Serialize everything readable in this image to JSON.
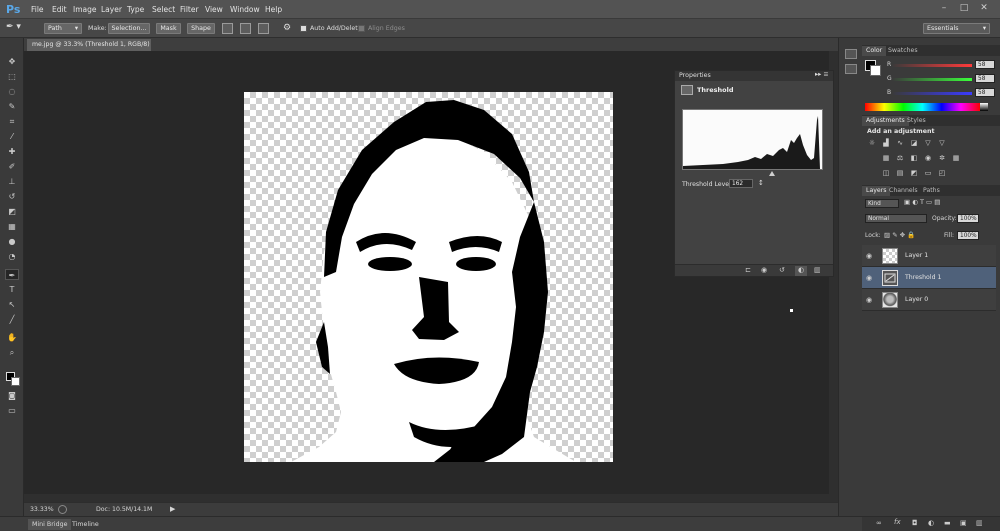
{
  "app": {
    "logo": "Ps"
  },
  "menu": [
    "File",
    "Edit",
    "Image",
    "Layer",
    "Type",
    "Select",
    "Filter",
    "View",
    "Window",
    "Help"
  ],
  "window_controls": {
    "minimize": "–",
    "maximize": "□",
    "close": "✕"
  },
  "options_bar": {
    "mode_value": "Path",
    "make_label": "Make:",
    "selection_label": "Selection...",
    "mask_label": "Mask",
    "shape_label": "Shape",
    "auto_add_delete": "Auto Add/Delete",
    "align_edges": "Align Edges",
    "workspace": "Essentials"
  },
  "document": {
    "tab_title": "me.jpg @ 33.3% (Threshold 1, RGB/8) *"
  },
  "status": {
    "zoom": "33.33%",
    "doc_info": "Doc: 10.5M/14.1M"
  },
  "bottom_tabs": [
    "Mini Bridge",
    "Timeline"
  ],
  "properties": {
    "tab": "Properties",
    "adjustment_name": "Threshold",
    "level_label": "Threshold Level:",
    "level_value": "162",
    "level": 162
  },
  "color_panel": {
    "tabs": [
      "Color",
      "Swatches"
    ],
    "channels": [
      {
        "label": "R",
        "value": "58"
      },
      {
        "label": "G",
        "value": "58"
      },
      {
        "label": "B",
        "value": "58"
      }
    ]
  },
  "adjustments_panel": {
    "tabs": [
      "Adjustments",
      "Styles"
    ],
    "heading": "Add an adjustment"
  },
  "layers_panel": {
    "tabs": [
      "Layers",
      "Channels",
      "Paths"
    ],
    "kind": "Kind",
    "blend_mode": "Normal",
    "opacity_label": "Opacity:",
    "opacity_value": "100%",
    "lock_label": "Lock:",
    "fill_label": "Fill:",
    "fill_value": "100%",
    "layers": [
      {
        "name": "Layer 1",
        "selected": false
      },
      {
        "name": "Threshold 1",
        "selected": true
      },
      {
        "name": "Layer 0",
        "selected": false
      }
    ]
  },
  "colors": {
    "accent_selected": "#4f617a",
    "panel": "#3a3a3a",
    "menubar": "#535353"
  }
}
